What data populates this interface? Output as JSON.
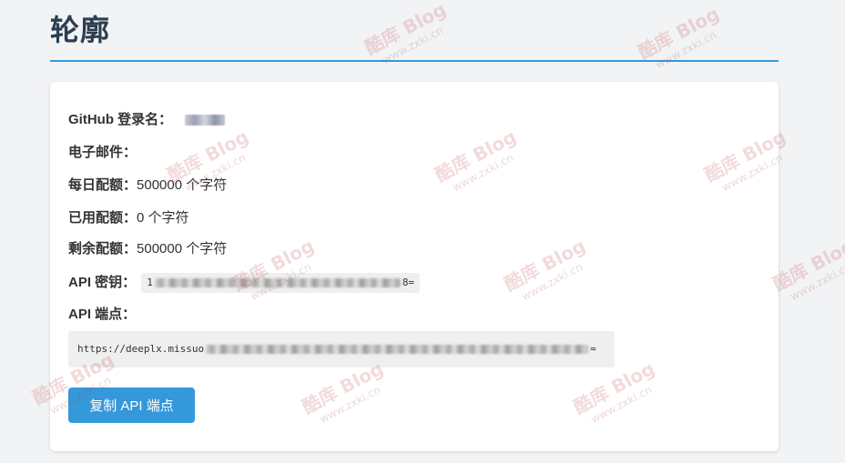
{
  "header": {
    "title": "轮廓"
  },
  "profile": {
    "github_login_label": "GitHub 登录名：",
    "email_label": "电子邮件：",
    "daily_quota_label": "每日配额：",
    "daily_quota_value": "500000 个字符",
    "used_quota_label": "已用配额：",
    "used_quota_value": "0 个字符",
    "remaining_quota_label": "剩余配额：",
    "remaining_quota_value": "500000 个字符",
    "api_key_label": "API 密钥：",
    "api_key_prefix": "1",
    "api_key_suffix": "8=",
    "api_endpoint_label": "API 端点：",
    "api_endpoint_prefix": "https://deeplx.missuo",
    "api_endpoint_suffix": "="
  },
  "actions": {
    "copy_endpoint_label": "复制 API 端点"
  },
  "watermark": {
    "brand": "酷库 Blog",
    "site": "www.zxki.cn"
  },
  "colors": {
    "accent": "#3498db",
    "title": "#2c3e50",
    "background": "#f2f3f5",
    "card": "#ffffff"
  }
}
